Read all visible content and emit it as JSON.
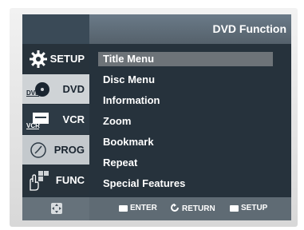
{
  "header": {
    "title": "DVD Function"
  },
  "sidebar": {
    "items": [
      {
        "label": "SETUP",
        "icon": "gear-icon"
      },
      {
        "label": "DVD",
        "icon": "dvd-icon"
      },
      {
        "label": "VCR",
        "icon": "vcr-icon"
      },
      {
        "label": "PROG",
        "icon": "clock-icon"
      },
      {
        "label": "FUNC",
        "icon": "hand-icon"
      }
    ]
  },
  "menu": {
    "items": [
      {
        "label": "Title Menu",
        "selected": true
      },
      {
        "label": "Disc Menu"
      },
      {
        "label": "Information"
      },
      {
        "label": "Zoom"
      },
      {
        "label": "Bookmark"
      },
      {
        "label": "Repeat"
      },
      {
        "label": "Special Features"
      }
    ]
  },
  "footer": {
    "nav_icon": "dpad-icon",
    "enter_label": "ENTER",
    "return_label": "RETURN",
    "setup_label": "SETUP"
  },
  "dvd_logo_text": "DVD",
  "vcr_logo_text": "VCR"
}
